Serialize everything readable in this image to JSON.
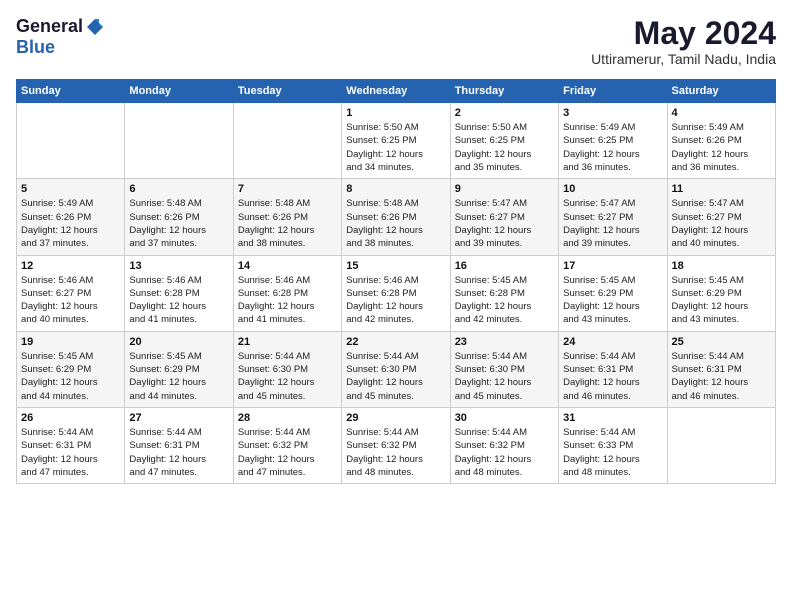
{
  "header": {
    "logo_general": "General",
    "logo_blue": "Blue",
    "title": "May 2024",
    "location": "Uttiramerur, Tamil Nadu, India"
  },
  "days_of_week": [
    "Sunday",
    "Monday",
    "Tuesday",
    "Wednesday",
    "Thursday",
    "Friday",
    "Saturday"
  ],
  "weeks": [
    [
      {
        "day": "",
        "info": ""
      },
      {
        "day": "",
        "info": ""
      },
      {
        "day": "",
        "info": ""
      },
      {
        "day": "1",
        "info": "Sunrise: 5:50 AM\nSunset: 6:25 PM\nDaylight: 12 hours\nand 34 minutes."
      },
      {
        "day": "2",
        "info": "Sunrise: 5:50 AM\nSunset: 6:25 PM\nDaylight: 12 hours\nand 35 minutes."
      },
      {
        "day": "3",
        "info": "Sunrise: 5:49 AM\nSunset: 6:25 PM\nDaylight: 12 hours\nand 36 minutes."
      },
      {
        "day": "4",
        "info": "Sunrise: 5:49 AM\nSunset: 6:26 PM\nDaylight: 12 hours\nand 36 minutes."
      }
    ],
    [
      {
        "day": "5",
        "info": "Sunrise: 5:49 AM\nSunset: 6:26 PM\nDaylight: 12 hours\nand 37 minutes."
      },
      {
        "day": "6",
        "info": "Sunrise: 5:48 AM\nSunset: 6:26 PM\nDaylight: 12 hours\nand 37 minutes."
      },
      {
        "day": "7",
        "info": "Sunrise: 5:48 AM\nSunset: 6:26 PM\nDaylight: 12 hours\nand 38 minutes."
      },
      {
        "day": "8",
        "info": "Sunrise: 5:48 AM\nSunset: 6:26 PM\nDaylight: 12 hours\nand 38 minutes."
      },
      {
        "day": "9",
        "info": "Sunrise: 5:47 AM\nSunset: 6:27 PM\nDaylight: 12 hours\nand 39 minutes."
      },
      {
        "day": "10",
        "info": "Sunrise: 5:47 AM\nSunset: 6:27 PM\nDaylight: 12 hours\nand 39 minutes."
      },
      {
        "day": "11",
        "info": "Sunrise: 5:47 AM\nSunset: 6:27 PM\nDaylight: 12 hours\nand 40 minutes."
      }
    ],
    [
      {
        "day": "12",
        "info": "Sunrise: 5:46 AM\nSunset: 6:27 PM\nDaylight: 12 hours\nand 40 minutes."
      },
      {
        "day": "13",
        "info": "Sunrise: 5:46 AM\nSunset: 6:28 PM\nDaylight: 12 hours\nand 41 minutes."
      },
      {
        "day": "14",
        "info": "Sunrise: 5:46 AM\nSunset: 6:28 PM\nDaylight: 12 hours\nand 41 minutes."
      },
      {
        "day": "15",
        "info": "Sunrise: 5:46 AM\nSunset: 6:28 PM\nDaylight: 12 hours\nand 42 minutes."
      },
      {
        "day": "16",
        "info": "Sunrise: 5:45 AM\nSunset: 6:28 PM\nDaylight: 12 hours\nand 42 minutes."
      },
      {
        "day": "17",
        "info": "Sunrise: 5:45 AM\nSunset: 6:29 PM\nDaylight: 12 hours\nand 43 minutes."
      },
      {
        "day": "18",
        "info": "Sunrise: 5:45 AM\nSunset: 6:29 PM\nDaylight: 12 hours\nand 43 minutes."
      }
    ],
    [
      {
        "day": "19",
        "info": "Sunrise: 5:45 AM\nSunset: 6:29 PM\nDaylight: 12 hours\nand 44 minutes."
      },
      {
        "day": "20",
        "info": "Sunrise: 5:45 AM\nSunset: 6:29 PM\nDaylight: 12 hours\nand 44 minutes."
      },
      {
        "day": "21",
        "info": "Sunrise: 5:44 AM\nSunset: 6:30 PM\nDaylight: 12 hours\nand 45 minutes."
      },
      {
        "day": "22",
        "info": "Sunrise: 5:44 AM\nSunset: 6:30 PM\nDaylight: 12 hours\nand 45 minutes."
      },
      {
        "day": "23",
        "info": "Sunrise: 5:44 AM\nSunset: 6:30 PM\nDaylight: 12 hours\nand 45 minutes."
      },
      {
        "day": "24",
        "info": "Sunrise: 5:44 AM\nSunset: 6:31 PM\nDaylight: 12 hours\nand 46 minutes."
      },
      {
        "day": "25",
        "info": "Sunrise: 5:44 AM\nSunset: 6:31 PM\nDaylight: 12 hours\nand 46 minutes."
      }
    ],
    [
      {
        "day": "26",
        "info": "Sunrise: 5:44 AM\nSunset: 6:31 PM\nDaylight: 12 hours\nand 47 minutes."
      },
      {
        "day": "27",
        "info": "Sunrise: 5:44 AM\nSunset: 6:31 PM\nDaylight: 12 hours\nand 47 minutes."
      },
      {
        "day": "28",
        "info": "Sunrise: 5:44 AM\nSunset: 6:32 PM\nDaylight: 12 hours\nand 47 minutes."
      },
      {
        "day": "29",
        "info": "Sunrise: 5:44 AM\nSunset: 6:32 PM\nDaylight: 12 hours\nand 48 minutes."
      },
      {
        "day": "30",
        "info": "Sunrise: 5:44 AM\nSunset: 6:32 PM\nDaylight: 12 hours\nand 48 minutes."
      },
      {
        "day": "31",
        "info": "Sunrise: 5:44 AM\nSunset: 6:33 PM\nDaylight: 12 hours\nand 48 minutes."
      },
      {
        "day": "",
        "info": ""
      }
    ]
  ]
}
